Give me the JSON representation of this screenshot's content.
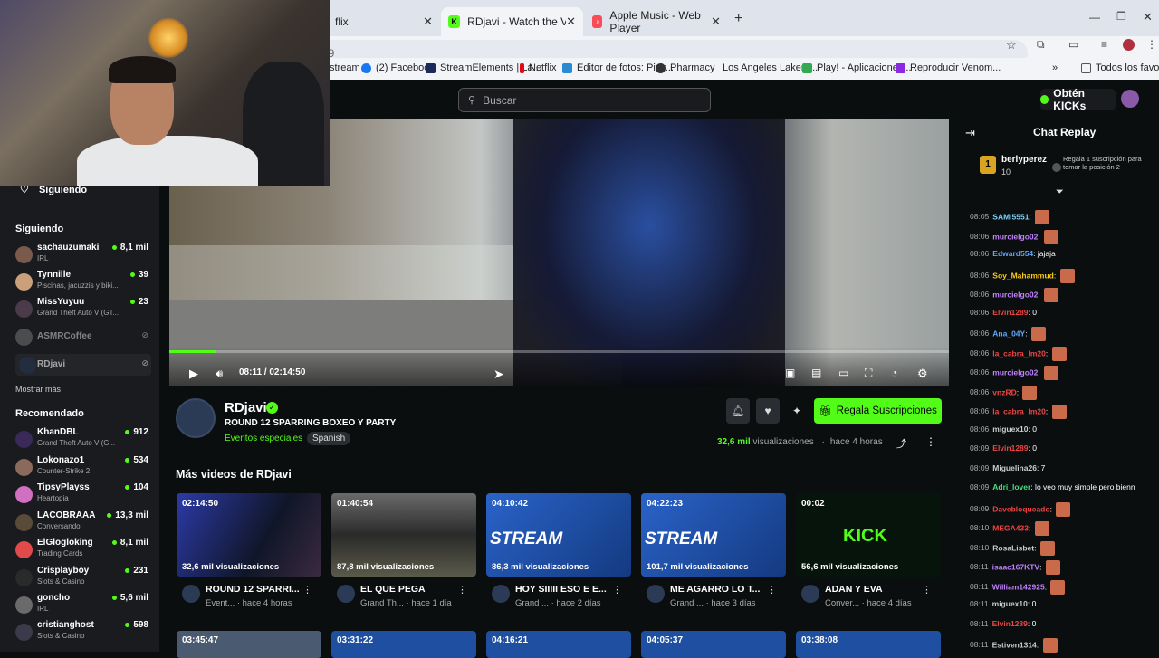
{
  "browser": {
    "tabs": [
      {
        "label": "flix",
        "active": false
      },
      {
        "label": "RDjavi - Watch the VOD on Kick",
        "active": true
      },
      {
        "label": "Apple Music - Web Player",
        "active": false
      }
    ],
    "new_tab": "+",
    "address_fragment": "39",
    "bookmarks": [
      "stream",
      "(2) Facebook",
      "StreamElements | La...",
      "Netflix",
      "Editor de fotos: Pixlr...",
      "Pharmacy",
      "Los Angeles Lakers...",
      "Play! - Aplicaciones...",
      "Reproducir Venom...",
      "Todos los favoritos"
    ]
  },
  "site": {
    "search_placeholder": "Buscar",
    "get_kicks": "Obtén KICKs"
  },
  "sidebar": {
    "following_title": "Siguiendo",
    "following_section": "Siguiendo",
    "following": [
      {
        "name": "sachauzumaki",
        "category": "IRL",
        "viewers": "8,1 mil"
      },
      {
        "name": "Tynnille",
        "category": "Piscinas, jacuzzis y biki...",
        "viewers": "39"
      },
      {
        "name": "MissYuyuu",
        "category": "Grand Theft Auto V (GT...",
        "viewers": "23"
      },
      {
        "name": "ASMRCoffee",
        "category": "",
        "viewers": ""
      },
      {
        "name": "RDjavi",
        "category": "",
        "viewers": ""
      }
    ],
    "show_more": "Mostrar más",
    "recommended_section": "Recomendado",
    "recommended": [
      {
        "name": "KhanDBL",
        "category": "Grand Theft Auto V (G...",
        "viewers": "912"
      },
      {
        "name": "Lokonazo1",
        "category": "Counter-Strike 2",
        "viewers": "534"
      },
      {
        "name": "TipsyPlayss",
        "category": "Heartopia",
        "viewers": "104"
      },
      {
        "name": "LACOBRAAA",
        "category": "Conversando",
        "viewers": "13,3 mil"
      },
      {
        "name": "ElGlogloking",
        "category": "Trading Cards",
        "viewers": "8,1 mil"
      },
      {
        "name": "Crisplayboy",
        "category": "Slots & Casino",
        "viewers": "231"
      },
      {
        "name": "goncho",
        "category": "IRL",
        "viewers": "5,6 mil"
      },
      {
        "name": "cristianghost",
        "category": "Slots & Casino",
        "viewers": "598"
      }
    ]
  },
  "player": {
    "time": "08:11 / 02:14:50",
    "progress_fraction": 0.06
  },
  "channel": {
    "name": "RDjavi",
    "stream_title": "ROUND 12 SPARRING  BOXEO Y PARTY",
    "category": "Eventos especiales",
    "language": "Spanish",
    "subscribe_label": "Regala Suscripciones",
    "views_count": "32,6 mil",
    "views_label": " visualizaciones",
    "time_ago": "hace 4 horas"
  },
  "more_videos": {
    "title": "Más videos de RDjavi",
    "videos": [
      {
        "duration": "02:14:50",
        "views": "32,6 mil visualizaciones",
        "title": "ROUND 12 SPARRI...",
        "sub": "Event...  · hace 4 horas",
        "color": "#2a3aa8"
      },
      {
        "duration": "01:40:54",
        "views": "87,8 mil visualizaciones",
        "title": "EL QUE PEGA",
        "sub": "Grand Th...  · hace 1 día",
        "color": "#4a4a4a"
      },
      {
        "duration": "04:10:42",
        "views": "86,3 mil visualizaciones",
        "title": "HOY SIIIII ESO E E...",
        "sub": "Grand ...  · hace 2 días",
        "color": "#1f4fa0"
      },
      {
        "duration": "04:22:23",
        "views": "101,7 mil visualizaciones",
        "title": "ME AGARRO LO T...",
        "sub": "Grand ...  · hace 3 días",
        "color": "#1f4fa0"
      },
      {
        "duration": "00:02",
        "views": "56,6 mil visualizaciones",
        "title": "ADAN Y EVA",
        "sub": "Conver...  · hace 4 días",
        "color": "#0a1a10"
      }
    ],
    "thumb_text_stream": "STREAM",
    "thumb_text_kick": "KICK",
    "row2_durations": [
      "03:45:47",
      "03:31:22",
      "04:16:21",
      "04:05:37",
      "03:38:08"
    ]
  },
  "chat": {
    "title": "Chat Replay",
    "pinned_user": "berlyperez",
    "pinned_count": "10",
    "pinned_note": "Regala 1 suscripción para tomar la posición 2",
    "messages": [
      {
        "time": "08:05",
        "user": "SAMI5551",
        "text": "",
        "color": "#7dd3fc",
        "emote": true
      },
      {
        "time": "08:06",
        "user": "murcielgo02",
        "text": "",
        "color": "#c084fc",
        "emote": true
      },
      {
        "time": "08:06",
        "user": "Edward554",
        "text": "jajaja",
        "color": "#60a5fa",
        "emote": false
      },
      {
        "time": "08:06",
        "user": "Soy_Mahammud",
        "text": "",
        "color": "#facc15",
        "emote": true
      },
      {
        "time": "08:06",
        "user": "murcielgo02",
        "text": "",
        "color": "#c084fc",
        "emote": true
      },
      {
        "time": "08:06",
        "user": "Elvin1289",
        "text": "0",
        "color": "#ef4444",
        "emote": false
      },
      {
        "time": "08:06",
        "user": "Ana_04Y",
        "text": "",
        "color": "#60a5fa",
        "emote": true
      },
      {
        "time": "08:06",
        "user": "la_cabra_lm20",
        "text": "",
        "color": "#ef4444",
        "emote": true
      },
      {
        "time": "08:06",
        "user": "murcielgo02",
        "text": "",
        "color": "#c084fc",
        "emote": true
      },
      {
        "time": "08:06",
        "user": "vnzRD",
        "text": "",
        "color": "#ef4444",
        "emote": true
      },
      {
        "time": "08:06",
        "user": "la_cabra_lm20",
        "text": "",
        "color": "#ef4444",
        "emote": true
      },
      {
        "time": "08:06",
        "user": "miguex10",
        "text": "0",
        "color": "#cccccc",
        "emote": false
      },
      {
        "time": "08:09",
        "user": "Elvin1289",
        "text": "0",
        "color": "#ef4444",
        "emote": false
      },
      {
        "time": "08:09",
        "user": "Miguelina26",
        "text": "7",
        "color": "#cccccc",
        "emote": false
      },
      {
        "time": "08:09",
        "user": "Adri_lover",
        "text": "lo veo muy simple pero bienn",
        "color": "#4ade80",
        "emote": false
      },
      {
        "time": "08:09",
        "user": "Davebloqueado",
        "text": "",
        "color": "#ef4444",
        "emote": true
      },
      {
        "time": "08:10",
        "user": "MEGA433",
        "text": "",
        "color": "#ef4444",
        "emote": true
      },
      {
        "time": "08:10",
        "user": "RosaLisbet",
        "text": "",
        "color": "#cccccc",
        "emote": true
      },
      {
        "time": "08:11",
        "user": "isaac167KTV",
        "text": "",
        "color": "#c084fc",
        "emote": true
      },
      {
        "time": "08:11",
        "user": "William142925",
        "text": "",
        "color": "#c084fc",
        "emote": true
      },
      {
        "time": "08:11",
        "user": "miguex10",
        "text": "0",
        "color": "#cccccc",
        "emote": false
      },
      {
        "time": "08:11",
        "user": "Elvin1289",
        "text": "0",
        "color": "#ef4444",
        "emote": false
      },
      {
        "time": "08:11",
        "user": "Estiven1314",
        "text": "",
        "color": "#cccccc",
        "emote": true
      }
    ]
  },
  "colors": {
    "accent": "#53fc18",
    "bg": "#0b0e0f",
    "panel": "#191b1f"
  }
}
